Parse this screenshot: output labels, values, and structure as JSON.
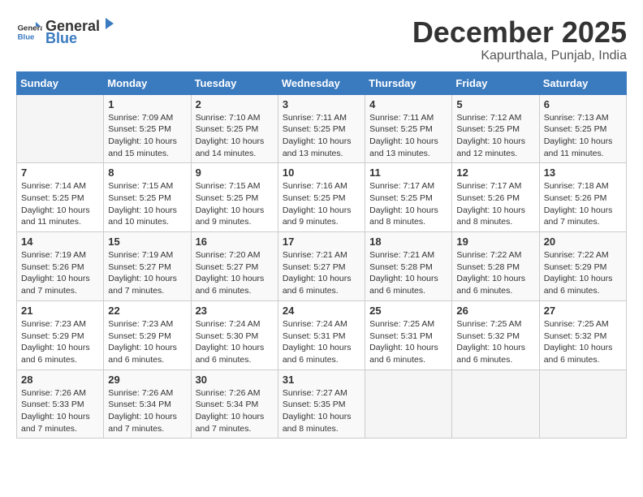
{
  "header": {
    "logo_general": "General",
    "logo_blue": "Blue",
    "month": "December 2025",
    "location": "Kapurthala, Punjab, India"
  },
  "calendar": {
    "weekdays": [
      "Sunday",
      "Monday",
      "Tuesday",
      "Wednesday",
      "Thursday",
      "Friday",
      "Saturday"
    ],
    "weeks": [
      [
        {
          "day": "",
          "info": ""
        },
        {
          "day": "1",
          "info": "Sunrise: 7:09 AM\nSunset: 5:25 PM\nDaylight: 10 hours\nand 15 minutes."
        },
        {
          "day": "2",
          "info": "Sunrise: 7:10 AM\nSunset: 5:25 PM\nDaylight: 10 hours\nand 14 minutes."
        },
        {
          "day": "3",
          "info": "Sunrise: 7:11 AM\nSunset: 5:25 PM\nDaylight: 10 hours\nand 13 minutes."
        },
        {
          "day": "4",
          "info": "Sunrise: 7:11 AM\nSunset: 5:25 PM\nDaylight: 10 hours\nand 13 minutes."
        },
        {
          "day": "5",
          "info": "Sunrise: 7:12 AM\nSunset: 5:25 PM\nDaylight: 10 hours\nand 12 minutes."
        },
        {
          "day": "6",
          "info": "Sunrise: 7:13 AM\nSunset: 5:25 PM\nDaylight: 10 hours\nand 11 minutes."
        }
      ],
      [
        {
          "day": "7",
          "info": "Sunrise: 7:14 AM\nSunset: 5:25 PM\nDaylight: 10 hours\nand 11 minutes."
        },
        {
          "day": "8",
          "info": "Sunrise: 7:15 AM\nSunset: 5:25 PM\nDaylight: 10 hours\nand 10 minutes."
        },
        {
          "day": "9",
          "info": "Sunrise: 7:15 AM\nSunset: 5:25 PM\nDaylight: 10 hours\nand 9 minutes."
        },
        {
          "day": "10",
          "info": "Sunrise: 7:16 AM\nSunset: 5:25 PM\nDaylight: 10 hours\nand 9 minutes."
        },
        {
          "day": "11",
          "info": "Sunrise: 7:17 AM\nSunset: 5:25 PM\nDaylight: 10 hours\nand 8 minutes."
        },
        {
          "day": "12",
          "info": "Sunrise: 7:17 AM\nSunset: 5:26 PM\nDaylight: 10 hours\nand 8 minutes."
        },
        {
          "day": "13",
          "info": "Sunrise: 7:18 AM\nSunset: 5:26 PM\nDaylight: 10 hours\nand 7 minutes."
        }
      ],
      [
        {
          "day": "14",
          "info": "Sunrise: 7:19 AM\nSunset: 5:26 PM\nDaylight: 10 hours\nand 7 minutes."
        },
        {
          "day": "15",
          "info": "Sunrise: 7:19 AM\nSunset: 5:27 PM\nDaylight: 10 hours\nand 7 minutes."
        },
        {
          "day": "16",
          "info": "Sunrise: 7:20 AM\nSunset: 5:27 PM\nDaylight: 10 hours\nand 6 minutes."
        },
        {
          "day": "17",
          "info": "Sunrise: 7:21 AM\nSunset: 5:27 PM\nDaylight: 10 hours\nand 6 minutes."
        },
        {
          "day": "18",
          "info": "Sunrise: 7:21 AM\nSunset: 5:28 PM\nDaylight: 10 hours\nand 6 minutes."
        },
        {
          "day": "19",
          "info": "Sunrise: 7:22 AM\nSunset: 5:28 PM\nDaylight: 10 hours\nand 6 minutes."
        },
        {
          "day": "20",
          "info": "Sunrise: 7:22 AM\nSunset: 5:29 PM\nDaylight: 10 hours\nand 6 minutes."
        }
      ],
      [
        {
          "day": "21",
          "info": "Sunrise: 7:23 AM\nSunset: 5:29 PM\nDaylight: 10 hours\nand 6 minutes."
        },
        {
          "day": "22",
          "info": "Sunrise: 7:23 AM\nSunset: 5:29 PM\nDaylight: 10 hours\nand 6 minutes."
        },
        {
          "day": "23",
          "info": "Sunrise: 7:24 AM\nSunset: 5:30 PM\nDaylight: 10 hours\nand 6 minutes."
        },
        {
          "day": "24",
          "info": "Sunrise: 7:24 AM\nSunset: 5:31 PM\nDaylight: 10 hours\nand 6 minutes."
        },
        {
          "day": "25",
          "info": "Sunrise: 7:25 AM\nSunset: 5:31 PM\nDaylight: 10 hours\nand 6 minutes."
        },
        {
          "day": "26",
          "info": "Sunrise: 7:25 AM\nSunset: 5:32 PM\nDaylight: 10 hours\nand 6 minutes."
        },
        {
          "day": "27",
          "info": "Sunrise: 7:25 AM\nSunset: 5:32 PM\nDaylight: 10 hours\nand 6 minutes."
        }
      ],
      [
        {
          "day": "28",
          "info": "Sunrise: 7:26 AM\nSunset: 5:33 PM\nDaylight: 10 hours\nand 7 minutes."
        },
        {
          "day": "29",
          "info": "Sunrise: 7:26 AM\nSunset: 5:34 PM\nDaylight: 10 hours\nand 7 minutes."
        },
        {
          "day": "30",
          "info": "Sunrise: 7:26 AM\nSunset: 5:34 PM\nDaylight: 10 hours\nand 7 minutes."
        },
        {
          "day": "31",
          "info": "Sunrise: 7:27 AM\nSunset: 5:35 PM\nDaylight: 10 hours\nand 8 minutes."
        },
        {
          "day": "",
          "info": ""
        },
        {
          "day": "",
          "info": ""
        },
        {
          "day": "",
          "info": ""
        }
      ]
    ]
  }
}
